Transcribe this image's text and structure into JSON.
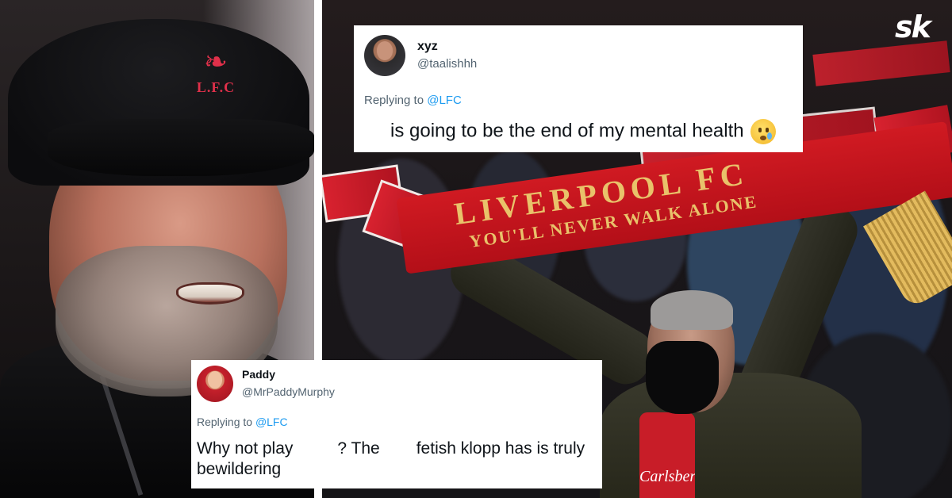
{
  "brand": {
    "logo_text": "sk"
  },
  "left_photo": {
    "cap_crest_text": "L.F.C"
  },
  "right_photo": {
    "scarf_line1": "LIVERPOOL FC",
    "scarf_line2": "YOU'LL NEVER WALK ALONE",
    "shirt_text": "Carlsberg"
  },
  "tweets": [
    {
      "display_name": "xyz",
      "handle": "@taalishhh",
      "replying_prefix": "Replying to ",
      "replying_to": "@LFC",
      "body": "is going to be the end of my mental health",
      "emoji": "face-holding-back-tears-icon"
    },
    {
      "display_name": "Paddy",
      "handle": "@MrPaddyMurphy",
      "replying_prefix": "Replying to ",
      "replying_to": "@LFC",
      "body_part1": "Why not play",
      "body_part2": "? The",
      "body_part3": "fetish klopp has is truly bewildering"
    }
  ],
  "colors": {
    "mention_blue": "#1d9bf0",
    "liverpool_red": "#c8102e",
    "scarf_gold": "#e9c26a"
  }
}
